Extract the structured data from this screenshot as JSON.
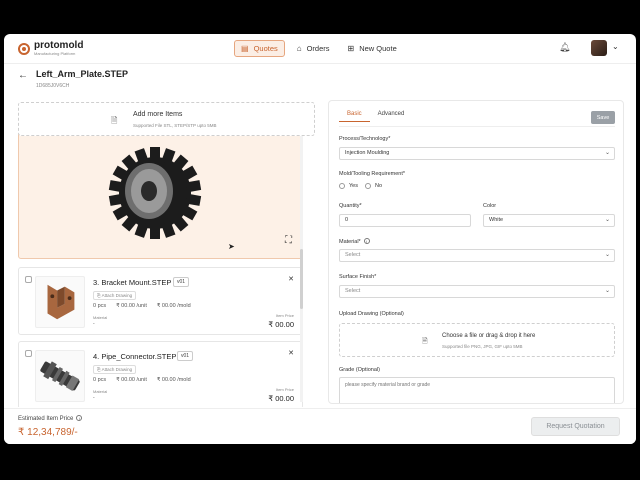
{
  "app": {
    "brand_name": "protomold",
    "brand_sub": "Manufacturing Platform",
    "nav": [
      {
        "label": "Quotes",
        "icon": "quotes-icon"
      },
      {
        "label": "Orders",
        "icon": "orders-icon"
      },
      {
        "label": "New Quote",
        "icon": "new-quote-icon"
      }
    ]
  },
  "file": {
    "title": "Left_Arm_Plate.STEP",
    "id": "1D685J0V6CH"
  },
  "upload_panel": {
    "title": "Add more Items",
    "subtitle": "Supported File STL, STEP/STP upto 5MB"
  },
  "items": [
    {
      "index_name": "3. Bracket Mount.STEP",
      "version": "v01",
      "attach": "Attach Drawing",
      "qty": "0 pcs",
      "unit": "₹ 00.00 /unit",
      "mold": "₹ 00.00 /mold",
      "material_label": "Material",
      "material_value": "-",
      "item_price_label": "Item Price",
      "item_price": "₹ 00.00"
    },
    {
      "index_name": "4. Pipe_Connector.STEP",
      "version": "v01",
      "attach": "Attach Drawing",
      "qty": "0 pcs",
      "unit": "₹ 00.00 /unit",
      "mold": "₹ 00.00 /mold",
      "material_label": "Material",
      "material_value": "-",
      "item_price_label": "Item Price",
      "item_price": "₹ 00.00"
    }
  ],
  "form": {
    "tabs": [
      "Basic",
      "Advanced"
    ],
    "save_label": "Save",
    "process_label": "Process/Technology*",
    "process_value": "Injection Moulding",
    "mold_label": "Mold/Tooling Requirement*",
    "mold_yes": "Yes",
    "mold_no": "No",
    "quantity_label": "Quantity*",
    "quantity_value": "0",
    "color_label": "Color",
    "color_value": "White",
    "material_label": "Material*",
    "material_value": "Select",
    "finish_label": "Surface Finish*",
    "finish_value": "Select",
    "upload_label": "Upload Drawing (Optional)",
    "upload_title": "Choose a file or drag & drop it here",
    "upload_sub": "Supported file PNG, JPG, GIF upto 5MB",
    "grade_label": "Grade (Optional)",
    "grade_placeholder": "please specify material brand or grade"
  },
  "footer": {
    "estimate_label": "Estimated Item Price",
    "estimate_value": "₹ 12,34,789/-",
    "request_label": "Request Quotation"
  },
  "colors": {
    "accent": "#c8642f",
    "preview_bg": "#fdf1e7"
  }
}
